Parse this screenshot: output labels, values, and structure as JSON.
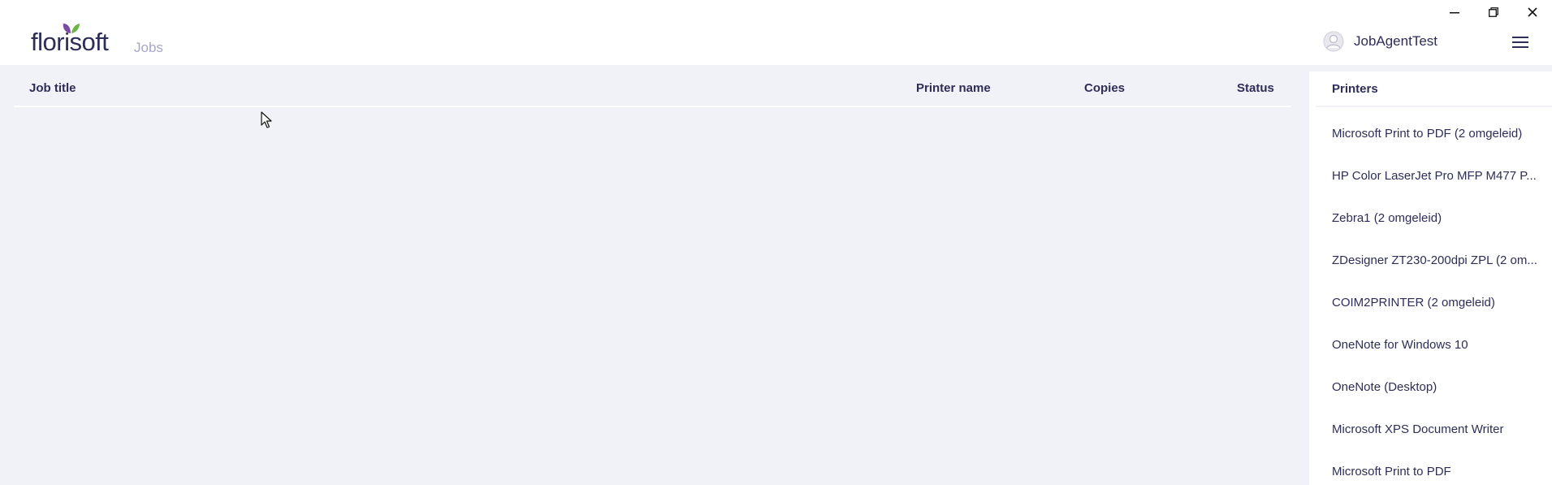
{
  "header": {
    "logo_text": "florisoft",
    "app_title": "Jobs",
    "user_name": "JobAgentTest"
  },
  "window_controls": {
    "minimize": "minimize-icon",
    "restore": "restore-icon",
    "close": "close-icon"
  },
  "jobs_table": {
    "columns": [
      "Job title",
      "Printer name",
      "Copies",
      "Status"
    ],
    "rows": []
  },
  "printers": {
    "title": "Printers",
    "items": [
      "Microsoft Print to PDF (2 omgeleid)",
      "HP Color LaserJet Pro MFP M477 P...",
      "Zebra1 (2 omgeleid)",
      "ZDesigner ZT230-200dpi ZPL (2 om...",
      "COIM2PRINTER (2 omgeleid)",
      "OneNote for Windows 10",
      "OneNote (Desktop)",
      "Microsoft XPS Document Writer",
      "Microsoft Print to PDF"
    ]
  },
  "colors": {
    "text": "#2e2d57",
    "muted": "#a7a6c7",
    "background": "#f1f2f7",
    "leaf_purple": "#7b4aa0",
    "leaf_green": "#6bb544"
  }
}
